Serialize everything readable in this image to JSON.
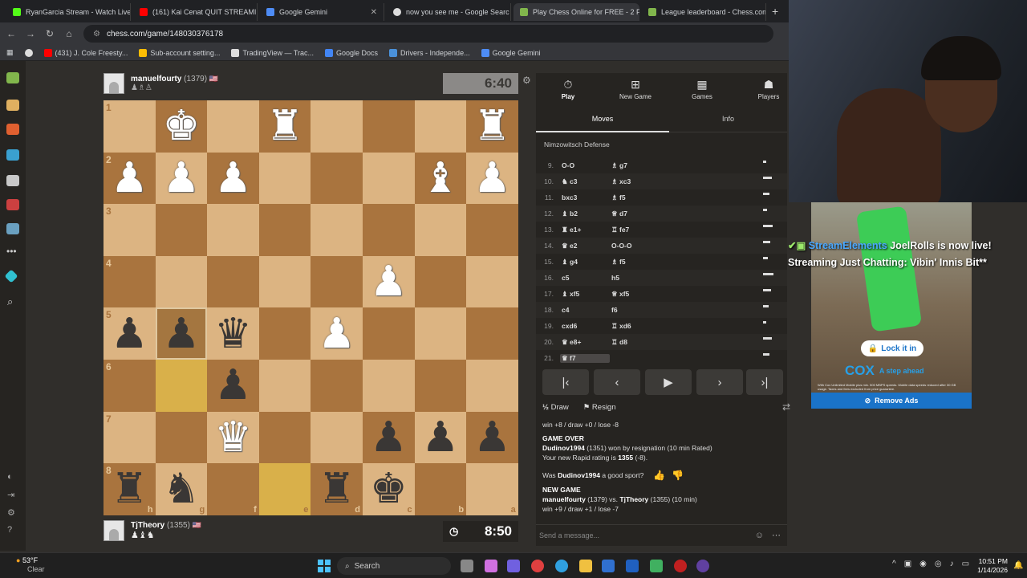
{
  "browser": {
    "tabs": [
      {
        "title": "RyanGarcia Stream - Watch Live",
        "color": "#53fc18",
        "active": false
      },
      {
        "title": "(161) Kai Cenat QUIT STREAMIN",
        "color": "#ff0000",
        "active": false
      },
      {
        "title": "Google Gemini",
        "color": "#4e8cf5",
        "active": false
      },
      {
        "title": "now you see me - Google Searc",
        "color": "#dddddd",
        "active": false
      },
      {
        "title": "Play Chess Online for FREE - 2 P",
        "color": "#81b64c",
        "active": true
      },
      {
        "title": "League leaderboard - Chess.com",
        "color": "#81b64c",
        "active": false
      }
    ],
    "url": "chess.com/game/148030376178",
    "bookmarks": [
      "(431) J. Cole Freesty...",
      "Sub-account setting...",
      "TradingView — Trac...",
      "Google Docs",
      "Drivers - Independe...",
      "Google Gemini"
    ]
  },
  "top_player": {
    "name": "manuelfourty",
    "rating": "(1379)",
    "clock": "6:40"
  },
  "bottom_player": {
    "name": "TjTheory",
    "rating": "(1355)",
    "clock": "8:50"
  },
  "board": {
    "orientation": "black",
    "rows": [
      [
        "",
        "wK",
        "",
        "wR",
        "",
        "",
        "",
        "wR"
      ],
      [
        "wP",
        "wP",
        "wP",
        "",
        "",
        "",
        "wB",
        "wP"
      ],
      [
        "",
        "",
        "",
        "",
        "",
        "",
        "",
        ""
      ],
      [
        "",
        "",
        "",
        "",
        "",
        "wP",
        "",
        ""
      ],
      [
        "bP",
        "bP",
        "bQ",
        "",
        "wP",
        "",
        "",
        ""
      ],
      [
        "",
        "",
        "bP",
        "",
        "",
        "",
        "",
        ""
      ],
      [
        "",
        "",
        "wQ",
        "",
        "",
        "bP",
        "bP",
        "bP"
      ],
      [
        "bR",
        "bN",
        "",
        "",
        "bR",
        "bK",
        "",
        ""
      ]
    ],
    "rank_labels": [
      "1",
      "2",
      "3",
      "4",
      "5",
      "6",
      "7",
      "8"
    ],
    "file_labels": [
      "h",
      "g",
      "f",
      "e",
      "d",
      "c",
      "b",
      "a"
    ]
  },
  "panel": {
    "tabs": [
      "Play",
      "New Game",
      "Games",
      "Players"
    ],
    "subtabs": [
      "Moves",
      "Info"
    ],
    "opening": "Nimzowitsch Defense",
    "moves": [
      {
        "num": "9.",
        "white": "O-O",
        "black": "g7",
        "bpiece": "♗"
      },
      {
        "num": "10.",
        "white": "c3",
        "wpiece": "♞",
        "black": "xc3",
        "bpiece": "♗"
      },
      {
        "num": "11.",
        "white": "bxc3",
        "black": "f5",
        "bpiece": "♗"
      },
      {
        "num": "12.",
        "white": "b2",
        "wpiece": "♝",
        "black": "d7",
        "bpiece": "♕"
      },
      {
        "num": "13.",
        "white": "e1+",
        "wpiece": "♜",
        "black": "fe7",
        "bpiece": "♖"
      },
      {
        "num": "14.",
        "white": "e2",
        "wpiece": "♛",
        "black": "O-O-O"
      },
      {
        "num": "15.",
        "white": "g4",
        "wpiece": "♝",
        "black": "f5",
        "bpiece": "♗"
      },
      {
        "num": "16.",
        "white": "c5",
        "black": "h5"
      },
      {
        "num": "17.",
        "white": "xf5",
        "wpiece": "♝",
        "black": "xf5",
        "bpiece": "♕"
      },
      {
        "num": "18.",
        "white": "c4",
        "black": "f6"
      },
      {
        "num": "19.",
        "white": "cxd6",
        "black": "xd6",
        "bpiece": "♖"
      },
      {
        "num": "20.",
        "white": "e8+",
        "wpiece": "♛",
        "black": "d8",
        "bpiece": "♖"
      },
      {
        "num": "21.",
        "white": "f7",
        "wpiece": "♛",
        "black": ""
      }
    ],
    "draw_label": "Draw",
    "resign_label": "Resign",
    "chat": {
      "score_line": "win +8 / draw +0 / lose -8",
      "game_over": "GAME OVER",
      "winner": "Dudinov1994",
      "result": "(1351) won by resignation (10 min Rated)",
      "new_rating_prefix": "Your new Rapid rating is",
      "new_rating": "1355",
      "new_rating_suffix": "(-8).",
      "sport_prefix": "Was",
      "sport_suffix": "a good sport?",
      "new_game": "NEW GAME",
      "new_game_white": "manuelfourty",
      "new_game_mid": "(1379) vs.",
      "new_game_black": "TjTheory",
      "new_game_rest": "(1355) (10 min)",
      "new_game_score": "win +9 / draw +1 / lose -7"
    },
    "message_placeholder": "Send a message..."
  },
  "overlay": {
    "source": "StreamElements",
    "text": "JoelRolls is now live! Streaming Just Chatting: Vibin' Innis Bit**"
  },
  "ad": {
    "button": "Lock it in",
    "brand": "COX",
    "tagline": "A step ahead",
    "fine_print": "With Cox Unlimited Mobile plus min. 500 MBPS speeds. Mobile data speeds reduced after 30 GB usage. Taxes and fees excluded from price guarantee.",
    "remove": "Remove Ads"
  },
  "taskbar": {
    "weather_temp": "53°F",
    "weather_desc": "Clear",
    "search_label": "Search",
    "time": "10:51 PM",
    "date": "1/14/2026"
  }
}
